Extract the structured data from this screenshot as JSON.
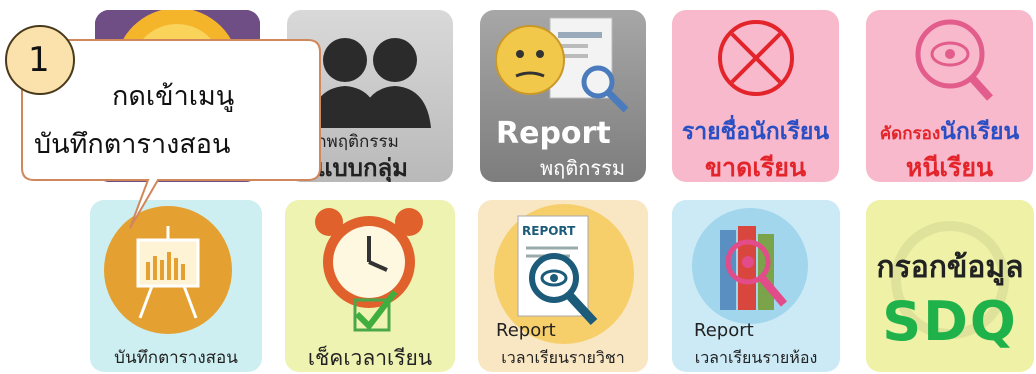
{
  "callout": {
    "step": "1",
    "line1": "กดเข้าเมนู",
    "line2": "บันทึกตารางสอน",
    "border_color": "#d0875b"
  },
  "row1": [
    {
      "name": "sun-tile",
      "label": ""
    },
    {
      "name": "group-behavior",
      "label_top": "ทึกพฤติกรรม",
      "label_bottom": "แบบกลุ่ม"
    },
    {
      "name": "report-behavior",
      "label_top": "Report",
      "label_bottom": "พฤติกรรม"
    },
    {
      "name": "absent-students",
      "label_top": "รายชื่อนักเรียน",
      "label_bottom": "ขาดเรียน"
    },
    {
      "name": "screen-truant",
      "label_top_a": "คัดกรอง",
      "label_top_b": "นักเรียน",
      "label_bottom": "หนีเรียน"
    }
  ],
  "row2": [
    {
      "name": "record-timetable",
      "label": "บันทึกตารางสอน"
    },
    {
      "name": "check-attendance-time",
      "label": "เช็คเวลาเรียน"
    },
    {
      "name": "report-subject-time",
      "label_top": "Report",
      "label_bottom": "เวลาเรียนรายวิชา",
      "icon_text": "REPORT"
    },
    {
      "name": "report-class-time",
      "label_top": "Report",
      "label_bottom": "เวลาเรียนรายห้อง"
    },
    {
      "name": "sdq-entry",
      "label_top": "กรอกข้อมูล",
      "label_bottom": "SDQ"
    }
  ],
  "colors": {
    "pink_tile": "#f7b9cb",
    "red_text": "#e3242b",
    "blue_text": "#2a4fc4",
    "green_sdq": "#1fb14a",
    "orange_circle": "#e4a030",
    "light_blue_tile": "#cdeff1",
    "light_yellow_tile": "#eff3b2"
  }
}
